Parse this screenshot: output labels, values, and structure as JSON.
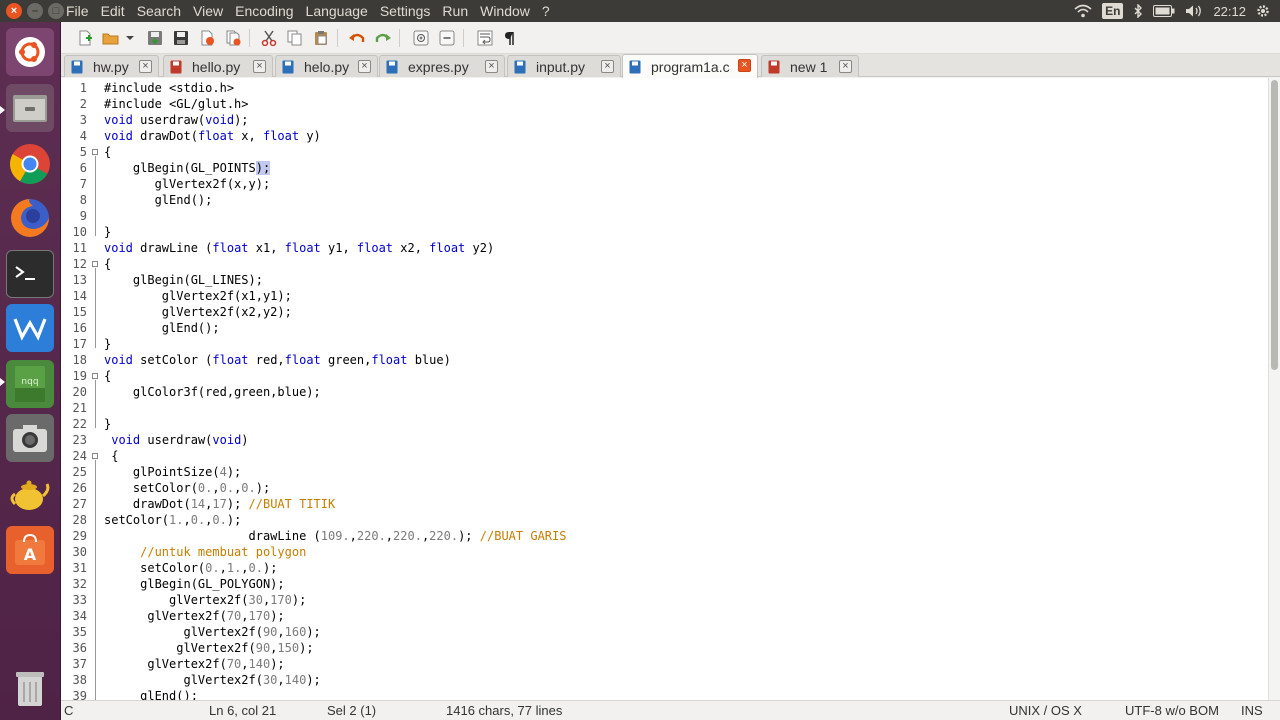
{
  "menubar": [
    "File",
    "Edit",
    "Search",
    "View",
    "Encoding",
    "Language",
    "Settings",
    "Run",
    "Window",
    "?"
  ],
  "indicators": {
    "lang": "En",
    "clock": "22:12"
  },
  "tabs": [
    {
      "label": "hw.py",
      "type": "saved"
    },
    {
      "label": "hello.py",
      "type": "modified"
    },
    {
      "label": "helo.py",
      "type": "saved"
    },
    {
      "label": "expres.py",
      "type": "saved"
    },
    {
      "label": "input.py",
      "type": "saved"
    },
    {
      "label": "program1a.c",
      "type": "saved",
      "active": true
    },
    {
      "label": "new 1",
      "type": "modified"
    }
  ],
  "code_lines": [
    "#include <stdio.h>",
    "#include <GL/glut.h>",
    "void userdraw(void);",
    "void drawDot(float x, float y)",
    "{",
    "    glBegin(GL_POINTS);",
    "       glVertex2f(x,y);",
    "       glEnd();",
    "",
    "}",
    "void drawLine (float x1, float y1, float x2, float y2)",
    "{",
    "    glBegin(GL_LINES);",
    "        glVertex2f(x1,y1);",
    "        glVertex2f(x2,y2);",
    "        glEnd();",
    "}",
    "void setColor (float red,float green,float blue)",
    "{",
    "    glColor3f(red,green,blue);",
    "",
    "}",
    " void userdraw(void)",
    " {",
    "    glPointSize(4);",
    "    setColor(0.,0.,0.);",
    "    drawDot(14,17); //BUAT TITIK",
    "setColor(1.,0.,0.);",
    "                    drawLine (109.,220.,220.,220.); //BUAT GARIS",
    "     //untuk membuat polygon",
    "     setColor(0.,1.,0.);",
    "     glBegin(GL_POLYGON);",
    "         glVertex2f(30,170);",
    "      glVertex2f(70,170);",
    "           glVertex2f(90,160);",
    "          glVertex2f(90,150);",
    "      glVertex2f(70,140);",
    "           glVertex2f(30,140);",
    "     glEnd();"
  ],
  "status": {
    "lang": "C",
    "position": "Ln 6, col 21",
    "selection": "Sel 2 (1)",
    "counts": "1416 chars, 77 lines",
    "eol": "UNIX / OS X",
    "encoding": "UTF-8 w/o BOM",
    "mode": "INS"
  },
  "colors": {
    "keyword": "#0000cc",
    "comment": "#c77e00",
    "number": "#7a7a7a",
    "accent": "#e95420",
    "launcher": "#5d2e51"
  }
}
